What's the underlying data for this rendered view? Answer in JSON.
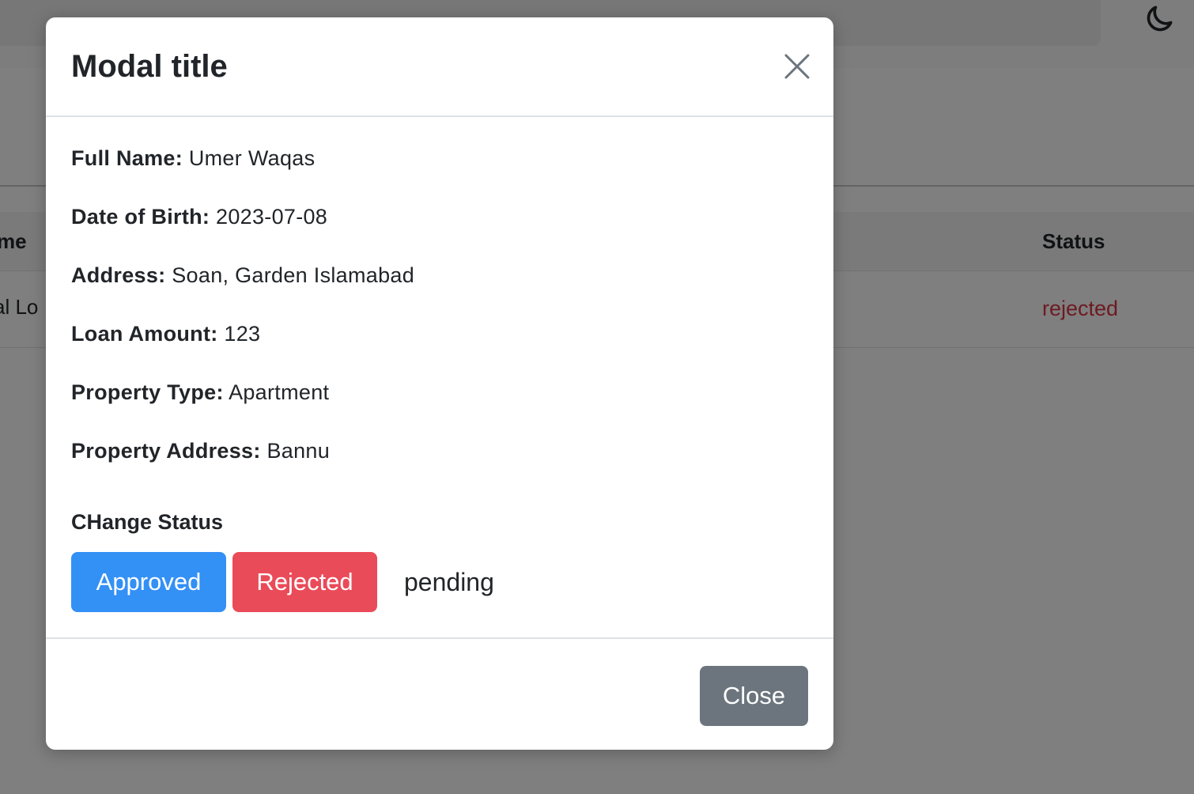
{
  "background": {
    "table_header_name_fragment": "me",
    "table_header_status": "Status",
    "row_name_fragment": "al Lo",
    "row_status": "rejected",
    "theme_toggle_icon": "moon-icon"
  },
  "modal": {
    "title": "Modal title",
    "close_icon": "close-icon",
    "fields": [
      {
        "label": "Full Name:",
        "value": "Umer Waqas"
      },
      {
        "label": "Date of Birth:",
        "value": "2023-07-08"
      },
      {
        "label": "Address:",
        "value": "Soan, Garden Islamabad"
      },
      {
        "label": "Loan Amount:",
        "value": "123"
      },
      {
        "label": "Property Type:",
        "value": "Apartment"
      },
      {
        "label": "Property Address:",
        "value": "Bannu"
      }
    ],
    "change_status_heading": "CHange Status",
    "approve_label": "Approved",
    "reject_label": "Rejected",
    "current_status": "pending",
    "close_button_label": "Close"
  },
  "colors": {
    "approve": "#3390f5",
    "reject": "#ea4b59",
    "close": "#6c757d",
    "status_rejected": "#dc3545"
  }
}
